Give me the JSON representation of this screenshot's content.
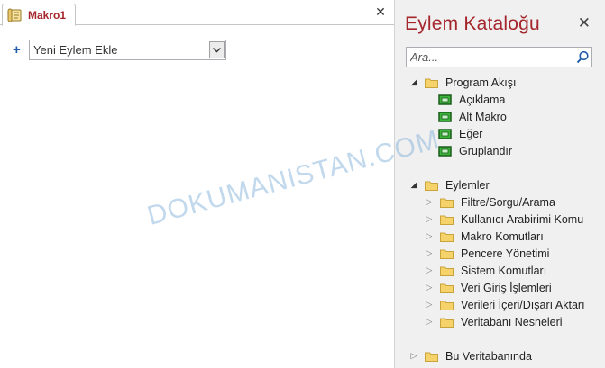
{
  "editor": {
    "tab_label": "Makro1",
    "close_symbol": "✕",
    "add_action": {
      "selected_value": "Yeni Eylem Ekle"
    }
  },
  "catalog": {
    "title": "Eylem Kataloğu",
    "close_symbol": "✕",
    "search": {
      "placeholder": "Ara..."
    },
    "program_flow": {
      "label": "Program Akışı",
      "items": [
        "Açıklama",
        "Alt Makro",
        "Eğer",
        "Gruplandır"
      ]
    },
    "actions": {
      "label": "Eylemler",
      "items": [
        "Filtre/Sorgu/Arama",
        "Kullanıcı Arabirimi Komu",
        "Makro Komutları",
        "Pencere Yönetimi",
        "Sistem Komutları",
        "Veri Giriş İşlemleri",
        "Verileri İçeri/Dışarı Aktarı",
        "Veritabanı Nesneleri"
      ]
    },
    "in_this_database": {
      "label": "Bu Veritabanında"
    }
  },
  "watermark": "DOKUMANISTAN.COM",
  "colors": {
    "accent": "#a4262c",
    "folder": "#f5d26a",
    "macro_icon": "#3cb43c"
  }
}
